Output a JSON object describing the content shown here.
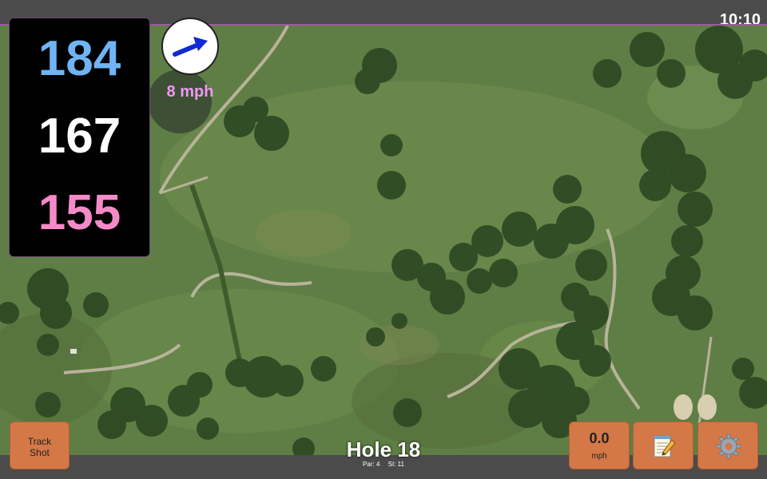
{
  "status_bar": {
    "time": "10:10"
  },
  "distances": {
    "back": "184",
    "middle": "167",
    "front": "155",
    "colors": {
      "back": "#6fb4f5",
      "middle": "#ffffff",
      "front": "#f48ac8"
    }
  },
  "wind": {
    "speed_label": "8 mph",
    "icon": "wind-direction-arrow-icon",
    "arrow_color": "#1029d6",
    "speed_color": "#ee99f0"
  },
  "buttons": {
    "track_shot_line1": "Track",
    "track_shot_line2": "Shot",
    "speed_value": "0.0",
    "speed_unit": "mph",
    "notes_icon": "notepad-pencil-icon",
    "settings_icon": "gear-icon"
  },
  "hole": {
    "title": "Hole 18",
    "par_label": "Par: 4",
    "si_label": "SI: 11"
  },
  "theme": {
    "button_color": "#d47847",
    "bar_color": "#4b4b4b",
    "map_grass": "#5f7e45"
  }
}
